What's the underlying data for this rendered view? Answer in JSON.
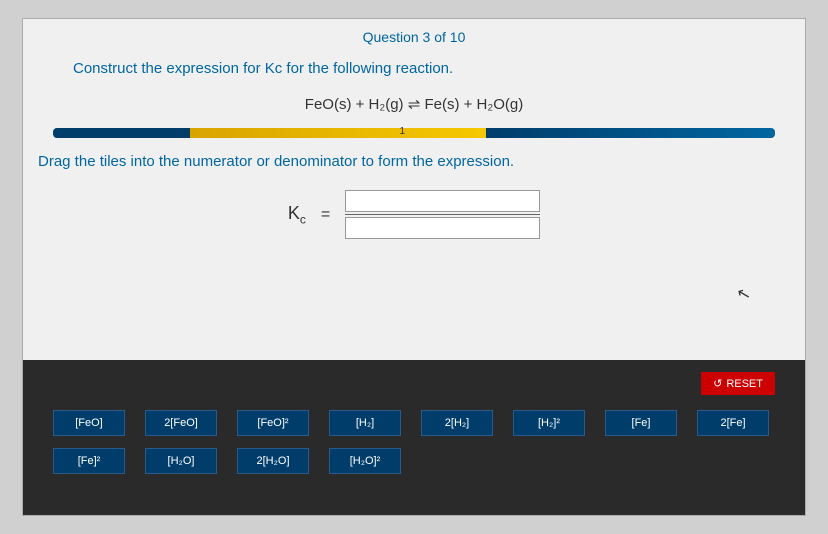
{
  "header": {
    "question_counter": "Question 3 of 10"
  },
  "prompt": {
    "instruction": "Construct the expression for Kc for the following reaction.",
    "reaction": "FeO(s) + H₂(g) ⇌ Fe(s) + H₂O(g)"
  },
  "progress": {
    "current_step": "1"
  },
  "drag": {
    "instruction": "Drag the tiles into the numerator or denominator to form the expression.",
    "kc_label_html": "K",
    "kc_sub": "c",
    "equals": "="
  },
  "reset": {
    "label": "RESET",
    "icon": "↺"
  },
  "tiles": {
    "row1": [
      "[FeO]",
      "2[FeO]",
      "[FeO]²",
      "[H₂]",
      "2[H₂]",
      "[H₂]²",
      "[Fe]",
      "2[Fe]"
    ],
    "row2": [
      "[Fe]²",
      "[H₂O]",
      "2[H₂O]",
      "[H₂O]²"
    ]
  }
}
